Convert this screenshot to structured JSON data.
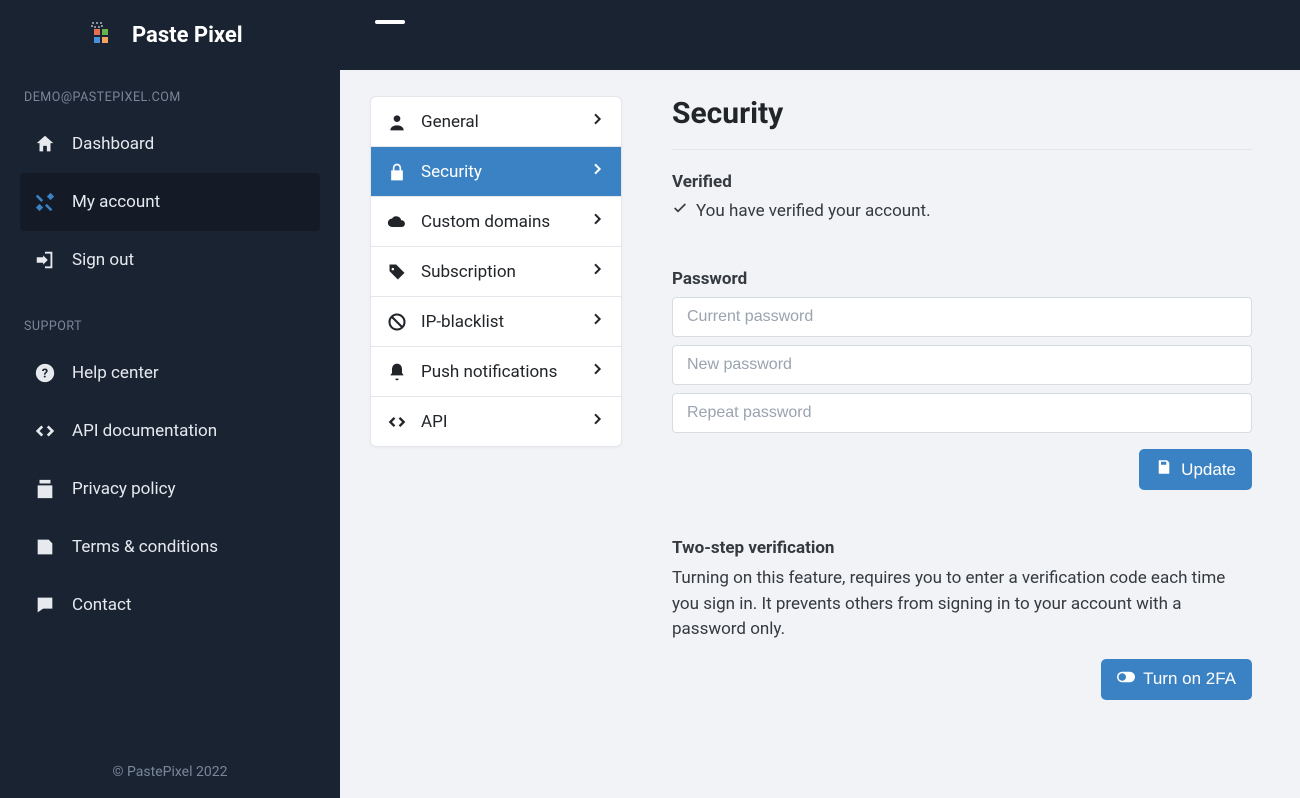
{
  "brand": {
    "name": "Paste Pixel"
  },
  "user_email": "DEMO@PASTEPIXEL.COM",
  "sidebar": {
    "sections": {
      "account": [
        {
          "label": "Dashboard",
          "icon": "home"
        },
        {
          "label": "My account",
          "icon": "wrench",
          "active": true
        },
        {
          "label": "Sign out",
          "icon": "signout"
        }
      ],
      "support_label": "SUPPORT",
      "support": [
        {
          "label": "Help center",
          "icon": "question"
        },
        {
          "label": "API documentation",
          "icon": "code"
        },
        {
          "label": "Privacy policy",
          "icon": "policy"
        },
        {
          "label": "Terms & conditions",
          "icon": "terms"
        },
        {
          "label": "Contact",
          "icon": "chat"
        }
      ]
    }
  },
  "footer": "© PastePixel 2022",
  "subnav": [
    {
      "label": "General",
      "icon": "user"
    },
    {
      "label": "Security",
      "icon": "lock",
      "active": true
    },
    {
      "label": "Custom domains",
      "icon": "cloud"
    },
    {
      "label": "Subscription",
      "icon": "tag"
    },
    {
      "label": "IP-blacklist",
      "icon": "ban"
    },
    {
      "label": "Push notifications",
      "icon": "bell"
    },
    {
      "label": "API",
      "icon": "code"
    }
  ],
  "page": {
    "title": "Security",
    "verified": {
      "heading": "Verified",
      "text": "You have verified your account."
    },
    "password": {
      "heading": "Password",
      "current_placeholder": "Current password",
      "new_placeholder": "New password",
      "repeat_placeholder": "Repeat password",
      "update_label": "Update"
    },
    "twofa": {
      "heading": "Two-step verification",
      "body": "Turning on this feature, requires you to enter a verification code each time you sign in. It prevents others from signing in to your account with a password only.",
      "button_label": "Turn on 2FA"
    }
  },
  "colors": {
    "accent": "#3b82c4",
    "sidebar_bg": "#1a2332",
    "main_bg": "#f1f3f6"
  }
}
